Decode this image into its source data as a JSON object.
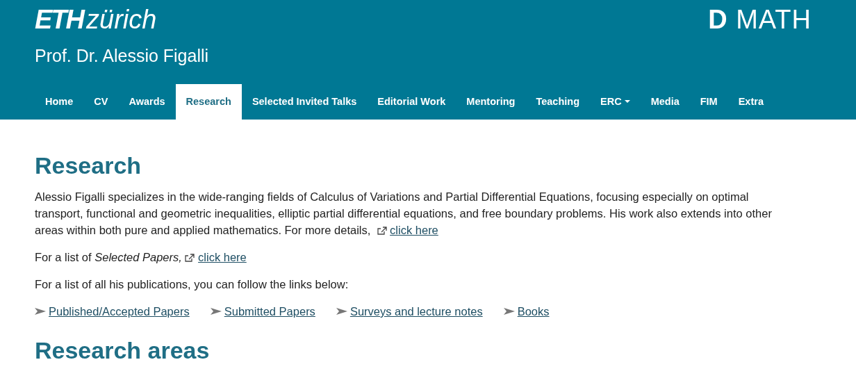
{
  "header": {
    "logo_bold": "ETH",
    "logo_light": "zürich",
    "department": {
      "bold": "D",
      "light": "MATH"
    },
    "person": "Prof. Dr. Alessio Figalli"
  },
  "nav": [
    {
      "label": "Home",
      "selected": false
    },
    {
      "label": "CV",
      "selected": false
    },
    {
      "label": "Awards",
      "selected": false
    },
    {
      "label": "Research",
      "selected": true
    },
    {
      "label": "Selected Invited Talks",
      "selected": false
    },
    {
      "label": "Editorial Work",
      "selected": false
    },
    {
      "label": "Mentoring",
      "selected": false
    },
    {
      "label": "Teaching",
      "selected": false
    },
    {
      "label": "ERC",
      "selected": false,
      "dropdown": true
    },
    {
      "label": "Media",
      "selected": false
    },
    {
      "label": "FIM",
      "selected": false
    },
    {
      "label": "Extra",
      "selected": false
    }
  ],
  "content": {
    "title": "Research",
    "intro": {
      "text": "Alessio Figalli specializes in the wide-ranging fields of Calculus of Variations and Partial Differential Equations, focusing especially on optimal transport, functional and geometric inequalities, elliptic partial differential equations, and free boundary problems. His work also extends into other areas within both pure and applied mathematics. For more details,",
      "link": "click here"
    },
    "selected_papers": {
      "text": "For a list of *Selected Papers,*",
      "link": "click here"
    },
    "publications_text": "For a list of all his publications, you can follow the links below:",
    "publication_links": [
      "Published/Accepted Papers",
      "Submitted Papers",
      "Surveys and lecture notes",
      "Books"
    ],
    "next_title": "Research areas"
  }
}
